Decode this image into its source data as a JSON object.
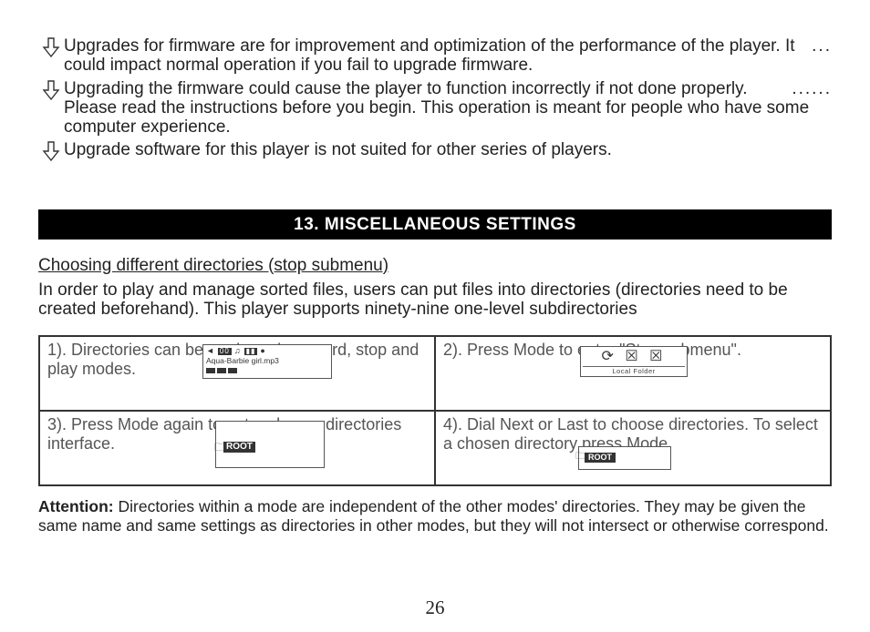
{
  "bullets": {
    "b1": "Upgrades for firmware are for improvement and optimization of the performance of the player. It could impact normal operation if you fail to upgrade firmware.",
    "b1_dots": "...",
    "b2": "Upgrading the firmware could cause the player to function incorrectly if not done properly. Please read the instructions before you begin. This operation is meant   for people who have some computer experience.",
    "b2_dots": "......",
    "b3": "Upgrade software for this player is not suited for other series of players."
  },
  "heading": "13. MISCELLANEOUS SETTINGS",
  "subheading": "Choosing different directories (stop submenu)",
  "intro": "In order to play and manage sorted files, users can put files into directories (directories need to be created beforehand). This player supports ninety-nine one-level subdirectories",
  "steps": {
    "s1": "1). Directories can be made under record, stop and play modes.",
    "s2": "2). Press Mode to enter \"Stop submenu\".",
    "s3": "3). Press Mode again to enter choose directories interface.",
    "s4": "4). Dial Next or Last to choose directories. To select a chosen directory press Mode."
  },
  "lcd": {
    "file": "Aqua-Barbie girl.mp3",
    "root": "ROOT",
    "local": "Local  Folder",
    "icons2": "⟳ ☒ ☒"
  },
  "attention_label": "Attention:",
  "attention_text": " Directories within a mode are independent of the other modes' directories. They may be given the same name and same settings as directories in other modes, but they will not intersect or otherwise correspond.",
  "page_number": "26"
}
